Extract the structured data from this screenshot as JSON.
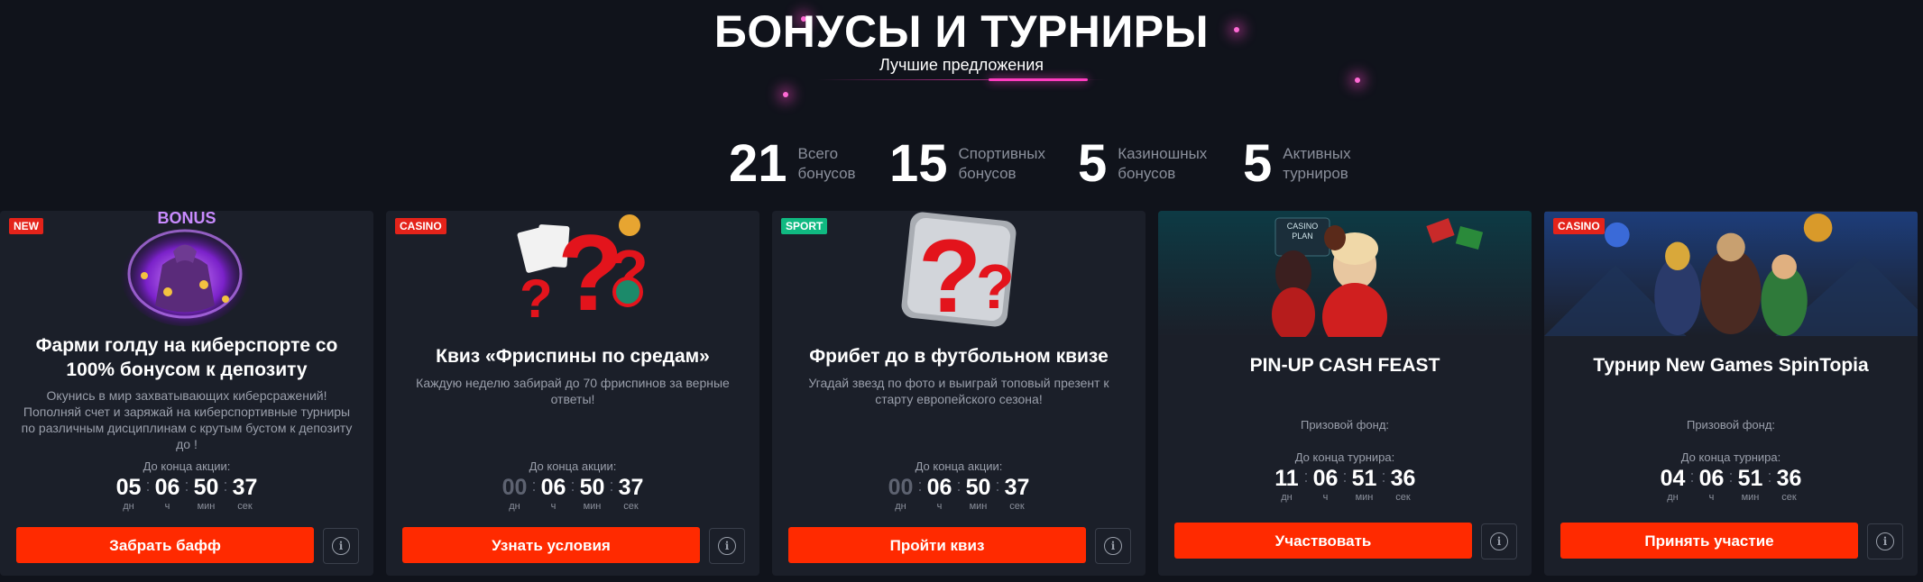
{
  "header": {
    "title": "БОНУСЫ И ТУРНИРЫ",
    "subtitle": "Лучшие предложения"
  },
  "stats": [
    {
      "value": "21",
      "label_line1": "Всего",
      "label_line2": "бонусов"
    },
    {
      "value": "15",
      "label_line1": "Спортивных",
      "label_line2": "бонусов"
    },
    {
      "value": "5",
      "label_line1": "Казиношных",
      "label_line2": "бонусов"
    },
    {
      "value": "5",
      "label_line1": "Активных",
      "label_line2": "турниров"
    }
  ],
  "cards": [
    {
      "badge": "NEW",
      "art_text": "BONUS",
      "title": "Фарми голду на киберспорте со 100% бонусом к депозиту",
      "description": "Окунись в мир захватывающих киберсражений! Пополняй счет и заряжай на киберспортивные турниры по различным дисциплинам с крутым бустом к депозиту до !",
      "timer_caption": "До конца акции:",
      "timer": [
        {
          "value": "05",
          "unit": "дн"
        },
        {
          "value": "06",
          "unit": "ч"
        },
        {
          "value": "50",
          "unit": "мин"
        },
        {
          "value": "37",
          "unit": "сек"
        }
      ],
      "button": "Забрать бафф",
      "info_icon": "i"
    },
    {
      "badge": "CASINO",
      "title": "Квиз «Фриспины по средам»",
      "description": "Каждую неделю забирай до 70 фриспинов за верные ответы!",
      "timer_caption": "До конца акции:",
      "timer": [
        {
          "value": "00",
          "unit": "дн"
        },
        {
          "value": "06",
          "unit": "ч"
        },
        {
          "value": "50",
          "unit": "мин"
        },
        {
          "value": "37",
          "unit": "сек"
        }
      ],
      "button": "Узнать условия",
      "info_icon": "i"
    },
    {
      "badge": "SPORT",
      "title": "Фрибет до в футбольном квизе",
      "description": "Угадай звезд по фото и выиграй топовый презент к старту европейского сезона!",
      "timer_caption": "До конца акции:",
      "timer": [
        {
          "value": "00",
          "unit": "дн"
        },
        {
          "value": "06",
          "unit": "ч"
        },
        {
          "value": "50",
          "unit": "мин"
        },
        {
          "value": "37",
          "unit": "сек"
        }
      ],
      "button": "Пройти квиз",
      "info_icon": "i"
    },
    {
      "art_text": "CASINO PLAN",
      "title": "PIN-UP CASH FEAST",
      "fund_label": "Призовой фонд:",
      "timer_caption": "До конца турнира:",
      "timer": [
        {
          "value": "11",
          "unit": "дн"
        },
        {
          "value": "06",
          "unit": "ч"
        },
        {
          "value": "51",
          "unit": "мин"
        },
        {
          "value": "36",
          "unit": "сек"
        }
      ],
      "button": "Участвовать",
      "info_icon": "i"
    },
    {
      "badge": "CASINO",
      "title": "Турнир New Games SpinTopia",
      "fund_label": "Призовой фонд:",
      "timer_caption": "До конца турнира:",
      "timer": [
        {
          "value": "04",
          "unit": "дн"
        },
        {
          "value": "06",
          "unit": "ч"
        },
        {
          "value": "51",
          "unit": "мин"
        },
        {
          "value": "36",
          "unit": "сек"
        }
      ],
      "button": "Принять участие",
      "info_icon": "i"
    }
  ],
  "colors": {
    "background": "#10131b",
    "card": "#1b1f29",
    "accent_button": "#ff2a00",
    "badge_red": "#e4231a",
    "badge_green": "#10b981",
    "glow_pink": "#ff3cc0"
  }
}
